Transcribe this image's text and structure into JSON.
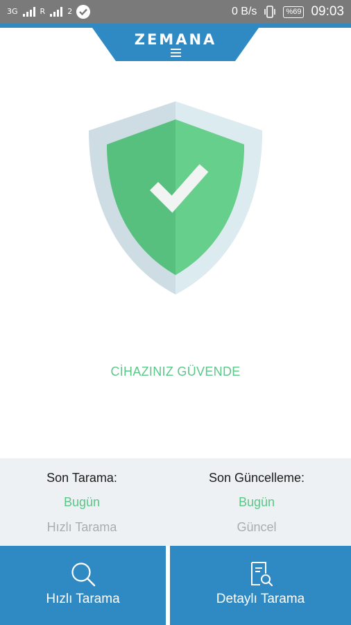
{
  "status_bar": {
    "network_type": "3G",
    "network_type_2": "R",
    "sim_index": "2",
    "data_speed": "0 B/s",
    "battery": "%69",
    "time": "09:03",
    "icons": [
      "signal-icon",
      "signal-icon",
      "check-badge-icon",
      "vibrate-icon",
      "battery-icon"
    ]
  },
  "header": {
    "brand": "ZEMANA",
    "menu_icon": "hamburger-menu-icon"
  },
  "colors": {
    "brand_blue": "#2f8ac3",
    "safe_green": "#5ac788",
    "shield_green_light": "#66cf8b",
    "shield_green_dark": "#58c07f",
    "shield_rim": "#d7e5ea",
    "panel_bg": "#edf1f3",
    "muted_text": "#a7adb0"
  },
  "status": {
    "message": "CİHAZINIZ GÜVENDE",
    "icon": "shield-check-icon"
  },
  "info": {
    "last_scan": {
      "label": "Son Tarama:",
      "value": "Bugün",
      "detail": "Hızlı Tarama"
    },
    "last_update": {
      "label": "Son Güncelleme:",
      "value": "Bugün",
      "detail": "Güncel"
    }
  },
  "actions": {
    "quick_scan": {
      "label": "Hızlı Tarama",
      "icon": "search-icon"
    },
    "detailed_scan": {
      "label": "Detaylı Tarama",
      "icon": "document-search-icon"
    }
  }
}
